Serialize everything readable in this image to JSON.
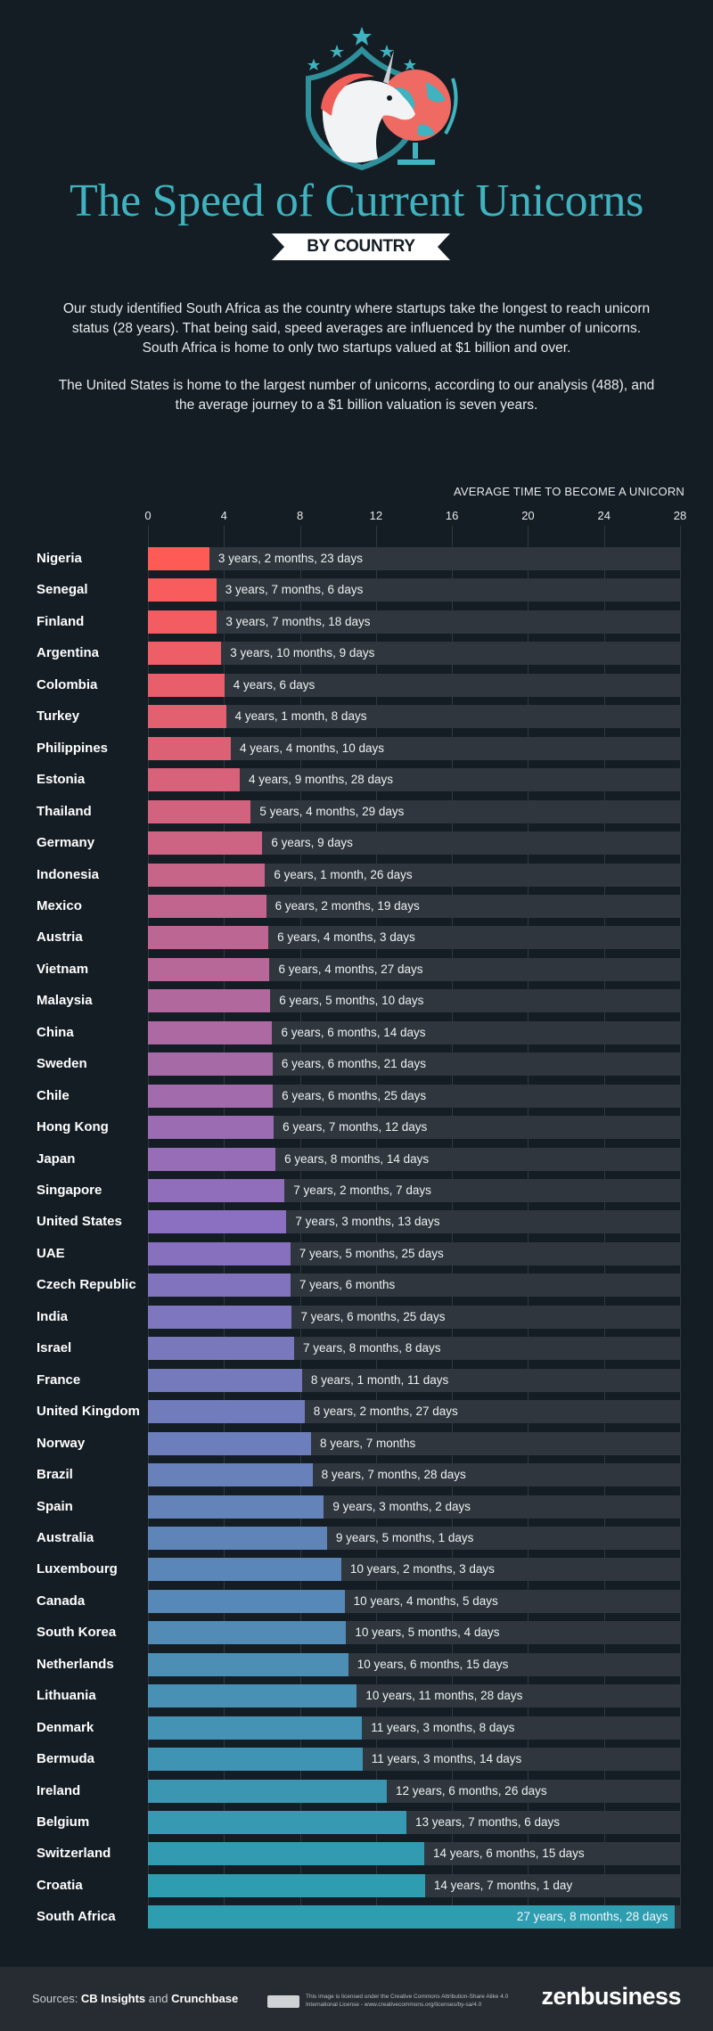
{
  "header": {
    "title": "The Speed of Current Unicorns",
    "subtitle_ribbon": "BY COUNTRY",
    "illustration": "unicorn-shield-globe-icon"
  },
  "intro": {
    "paragraph_1": "Our study identified South Africa as the country where startups take the longest to reach unicorn status (28 years). That being said, speed averages are influenced by the number of unicorns. South Africa is home to only two startups valued at $1 billion and over.",
    "paragraph_2": "The United States is home to the largest number of unicorns, according to our analysis (488), and the average journey to a $1 billion valuation is seven years."
  },
  "colors": {
    "background": "#141d24",
    "track": "#2f363d",
    "title": "#3fb3bf",
    "bar_start": "#fe5b57",
    "bar_mid": "#8b6fc0",
    "bar_end": "#2e9db0"
  },
  "chart_data": {
    "type": "bar",
    "orientation": "horizontal",
    "title": "AVERAGE TIME TO BECOME A UNICORN",
    "xlabel": "AVERAGE TIME TO BECOME A UNICORN",
    "ylabel": "",
    "xlim": [
      0,
      28
    ],
    "x_ticks": [
      "0",
      "4",
      "8",
      "12",
      "16",
      "20",
      "24",
      "28"
    ],
    "unit": "years",
    "grid": true,
    "categories": [
      "Nigeria",
      "Senegal",
      "Finland",
      "Argentina",
      "Colombia",
      "Turkey",
      "Philippines",
      "Estonia",
      "Thailand",
      "Germany",
      "Indonesia",
      "Mexico",
      "Austria",
      "Vietnam",
      "Malaysia",
      "China",
      "Sweden",
      "Chile",
      "Hong Kong",
      "Japan",
      "Singapore",
      "United States",
      "UAE",
      "Czech Republic",
      "India",
      "Israel",
      "France",
      "United Kingdom",
      "Norway",
      "Brazil",
      "Spain",
      "Australia",
      "Luxembourg",
      "Canada",
      "South Korea",
      "Netherlands",
      "Lithuania",
      "Denmark",
      "Bermuda",
      "Ireland",
      "Belgium",
      "Switzerland",
      "Croatia",
      "South Africa"
    ],
    "values": [
      3.23,
      3.6,
      3.63,
      3.86,
      4.02,
      4.11,
      4.36,
      4.83,
      5.41,
      6.02,
      6.16,
      6.22,
      6.34,
      6.4,
      6.44,
      6.54,
      6.56,
      6.57,
      6.62,
      6.71,
      7.19,
      7.29,
      7.49,
      7.5,
      7.57,
      7.69,
      8.11,
      8.24,
      8.58,
      8.66,
      9.26,
      9.42,
      10.17,
      10.35,
      10.43,
      10.54,
      10.99,
      11.27,
      11.29,
      12.57,
      13.6,
      14.54,
      14.58,
      27.74
    ],
    "labels": [
      "3 years, 2 months, 23 days",
      "3 years, 7 months, 6 days",
      "3 years, 7 months, 18 days",
      "3 years, 10 months, 9 days",
      "4 years,  6 days",
      "4 years, 1 month, 8 days",
      "4 years, 4 months, 10 days",
      "4 years,  9 months, 28 days",
      "5 years, 4 months, 29 days",
      "6 years,  9 days",
      "6 years, 1 month, 26 days",
      "6 years, 2 months, 19  days",
      "6 years, 4 months, 3 days",
      "6 years, 4 months, 27 days",
      "6 years, 5 months, 10 days",
      "6 years, 6 months, 14 days",
      "6 years, 6 months, 21 days",
      "6 years, 6 months, 25 days",
      "6 years, 7 months, 12 days",
      "6 years, 8 months, 14 days",
      "7 years, 2 months, 7 days",
      "7 years, 3 months, 13 days",
      "7 years, 5 months, 25 days",
      "7 years, 6 months",
      "7 years, 6 months, 25 days",
      "7 years, 8 months, 8 days",
      "8 years, 1 month, 11 days",
      "8 years, 2 months, 27 days",
      "8 years, 7 months",
      "8 years, 7 months, 28 days",
      "9 years, 3 months, 2 days",
      "9 years, 5 months, 1 days",
      "10 years, 2 months, 3 days",
      "10 years, 4 months, 5 days",
      "10 years, 5 months, 4 days",
      "10 years, 6 months, 15 days",
      "10 years, 11 months, 28 days",
      "11 years, 3 months, 8 days",
      "11 years, 3 months, 14 days",
      "12 years, 6 months, 26 days",
      "13 years, 7 months, 6 days",
      "14 years, 6 months, 15 days",
      "14 years, 7 months, 1 day",
      "27 years, 8 months, 28 days"
    ]
  },
  "footer": {
    "sources_prefix": "Sources: ",
    "source_1": "CB Insights",
    "sources_joiner": " and ",
    "source_2": "Crunchbase",
    "license_icon": "creative-commons-by-sa-icon",
    "license_text": "This image is licensed under the Creative Commons Attribution-Share Alike 4.0 International License - www.creativecommons.org/licenses/by-sa/4.0",
    "brand": "zenbusiness"
  }
}
